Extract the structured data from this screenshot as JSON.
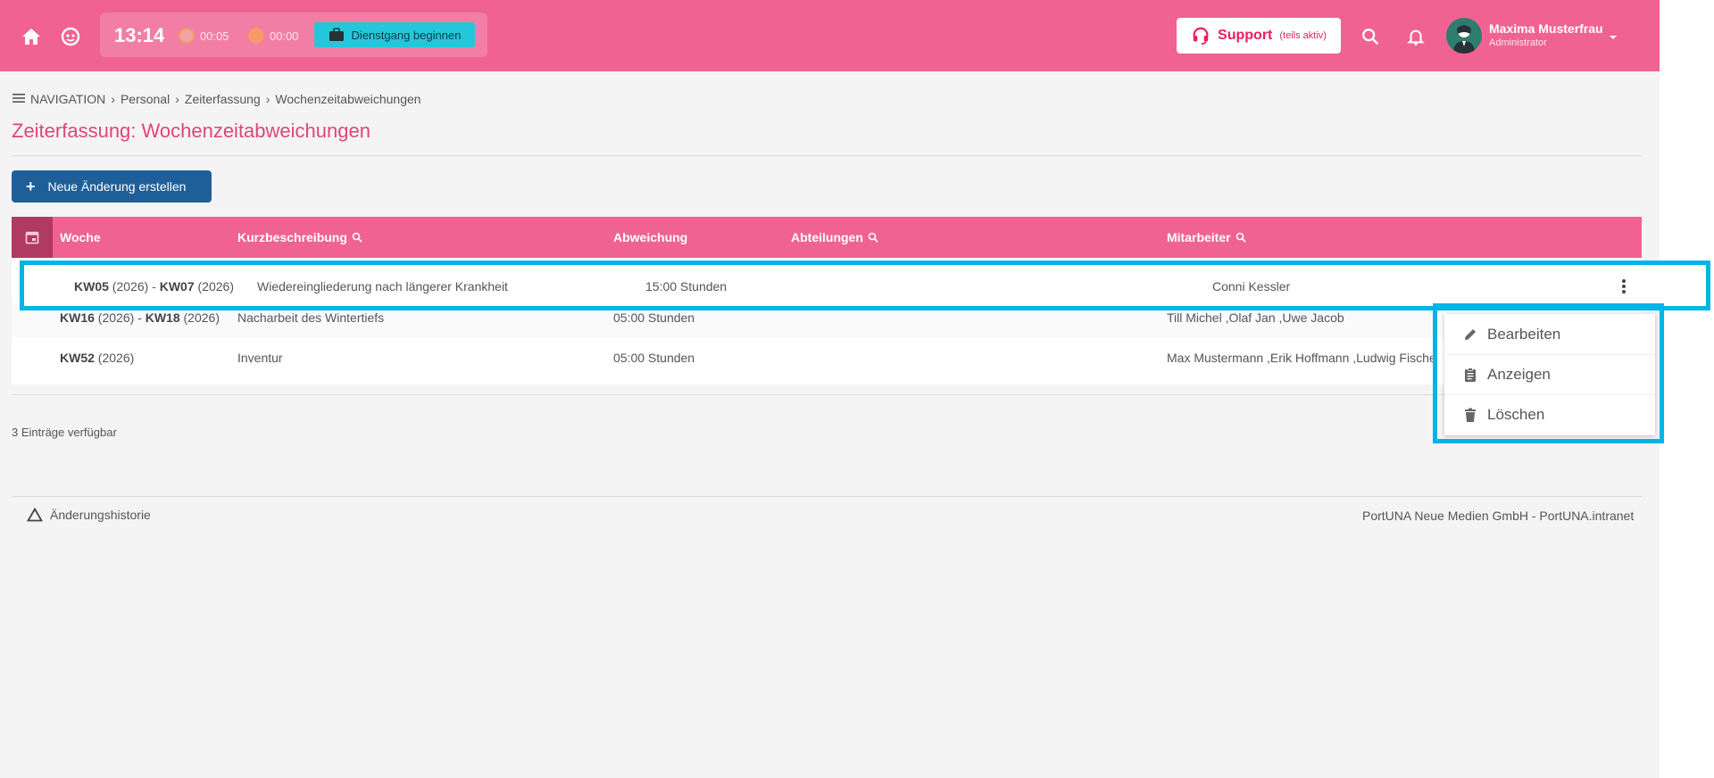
{
  "topbar": {
    "clock": "13:14",
    "timer_break": "00:05",
    "timer_pause": "00:00",
    "duty_button": "Dienstgang beginnen",
    "support_label": "Support",
    "support_sub": "(teils aktiv)",
    "user_name": "Maxima Musterfrau",
    "user_role": "Administrator"
  },
  "breadcrumb": {
    "nav": "NAVIGATION",
    "items": [
      "Personal",
      "Zeiterfassung",
      "Wochenzeitabweichungen"
    ]
  },
  "page": {
    "title": "Zeiterfassung: Wochenzeitabweichungen",
    "new_button": "Neue Änderung erstellen",
    "count": "3 Einträge verfügbar"
  },
  "table": {
    "headers": [
      "Woche",
      "Kurzbeschreibung",
      "Abweichung",
      "Abteilungen",
      "Mitarbeiter"
    ],
    "rows": [
      {
        "week_a": "KW05",
        "year_a": " (2026) - ",
        "week_b": "KW07",
        "year_b": " (2026)",
        "desc": "Wiedereingliederung nach längerer Krankheit",
        "dev": "15:00 Stunden",
        "dept": "",
        "emp": "Conni Kessler"
      },
      {
        "week_a": "KW16",
        "year_a": " (2026) - ",
        "week_b": "KW18",
        "year_b": " (2026)",
        "desc": "Nacharbeit des Wintertiefs",
        "dev": "05:00 Stunden",
        "dept": "",
        "emp": "Till Michel ,Olaf Jan ,Uwe Jacob"
      },
      {
        "week_a": "KW52",
        "year_a": " (2026)",
        "week_b": "",
        "year_b": "",
        "desc": "Inventur",
        "dev": "05:00 Stunden",
        "dept": "",
        "emp": "Max Mustermann ,Erik Hoffmann ,Ludwig Fische"
      }
    ]
  },
  "context_menu": {
    "items": [
      "Bearbeiten",
      "Anzeigen",
      "Löschen"
    ]
  },
  "footer": {
    "history": "Änderungshistorie",
    "company": "PortUNA Neue Medien GmbH - PortUNA.intranet"
  },
  "colors": {
    "brand_pink": "#f06292",
    "title_pink": "#e0457b",
    "primary_blue": "#1f5f99",
    "highlight_cyan": "#00b4e8",
    "duty_teal": "#26c6da"
  }
}
